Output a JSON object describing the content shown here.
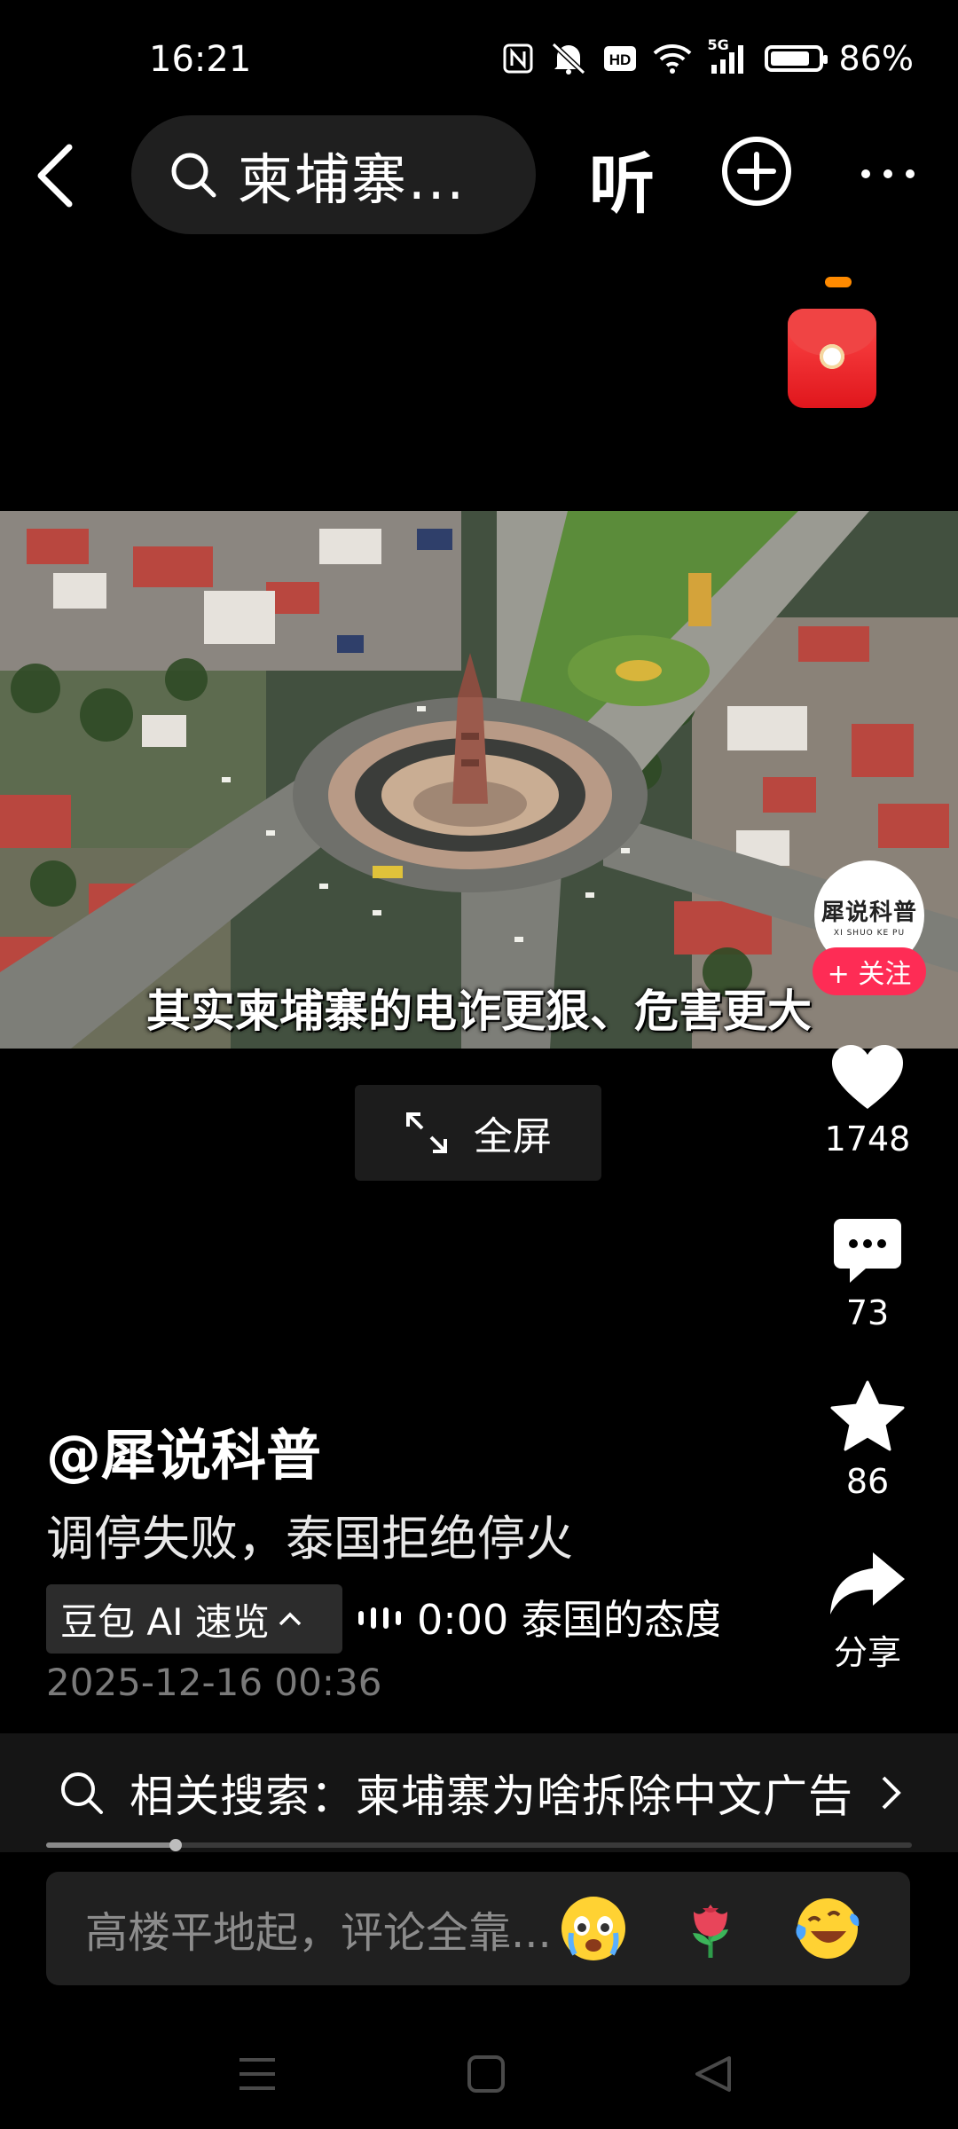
{
  "status_bar": {
    "time": "16:21",
    "signal_label": "5G",
    "battery_percent": 86,
    "battery_text": "86%",
    "icons": [
      "nfc-icon",
      "mute-icon",
      "hd-icon",
      "wifi-icon",
      "cellular-5g-icon",
      "battery-icon"
    ]
  },
  "top_nav": {
    "back_icon": "chevron-left-icon",
    "search_query": "柬埔寨...",
    "listen_label": "听",
    "add_icon": "plus-circle-icon",
    "more_icon": "more-dots-icon"
  },
  "video": {
    "subtitle": "其实柬埔寨的电诈更狠、危害更大",
    "fullscreen_label": "全屏"
  },
  "creator": {
    "avatar_text": "犀说科普",
    "avatar_subtext": "XI SHUO KE PU",
    "follow_label": "+ 关注"
  },
  "actions": {
    "likes": "1748",
    "comments": "73",
    "favorites": "86",
    "share_label": "分享"
  },
  "post": {
    "author": "@犀说科普",
    "description": "调停失败，泰国拒绝停火",
    "ai_summary_label": "豆包 AI 速览",
    "ai_ticker": "0:00 泰国的态度",
    "datetime": "2025-12-16 00:36"
  },
  "related_search": {
    "text": "相关搜索：柬埔寨为啥拆除中文广告"
  },
  "playback": {
    "progress": 0.15
  },
  "comment": {
    "placeholder": "高楼平地起，评论全靠...",
    "emojis": [
      "crying-emoji-icon",
      "rose-emoji-icon",
      "laughing-tears-emoji-icon"
    ]
  },
  "colors": {
    "accent": "#fe2c55",
    "background": "#000000"
  }
}
